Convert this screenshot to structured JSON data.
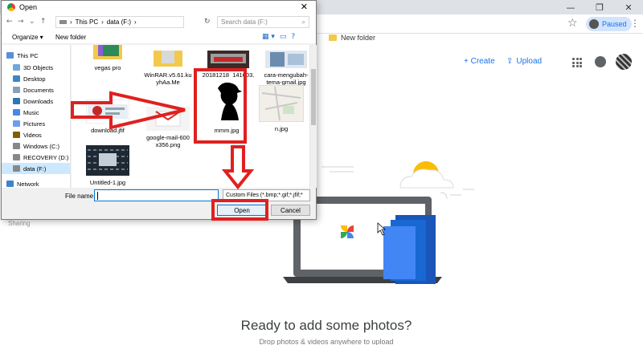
{
  "browser": {
    "window_controls": {
      "minimize": "—",
      "restore": "❐",
      "close": "✕"
    },
    "star": "☆",
    "profile_status": "Paused",
    "menu": "⋮",
    "bookmark_folder": "New folder"
  },
  "photos": {
    "create_label": "+ Create",
    "upload_label": "Upload",
    "upload_icon": "⇪",
    "sharing_label": "Sharing",
    "ready_title": "Ready to add some photos?",
    "drop_hint": "Drop photos & videos anywhere to upload"
  },
  "dialog": {
    "title": "Open",
    "close": "✕",
    "nav": {
      "back": "←",
      "forward": "→",
      "dropdown": "⌄",
      "up": "↑"
    },
    "address": {
      "this_pc": "This PC",
      "sep": "›",
      "drive": "data (F:)"
    },
    "refresh": "↻",
    "search_placeholder": "Search data (F:)",
    "search_icon": "⌕",
    "organize_label": "Organize ▾",
    "new_folder_label": "New folder",
    "view_icons": {
      "view": "▦ ▾",
      "pane": "▭",
      "help": "?"
    },
    "nav_items": [
      {
        "label": "This PC",
        "color": "#5b8ed6"
      },
      {
        "label": "3D Objects",
        "color": "#6fa8dc"
      },
      {
        "label": "Desktop",
        "color": "#3d85c6"
      },
      {
        "label": "Documents",
        "color": "#8aa0b8"
      },
      {
        "label": "Downloads",
        "color": "#2e75b6"
      },
      {
        "label": "Music",
        "color": "#4a86e8"
      },
      {
        "label": "Pictures",
        "color": "#6d9eeb"
      },
      {
        "label": "Videos",
        "color": "#7f6000"
      },
      {
        "label": "Windows (C:)",
        "color": "#888888"
      },
      {
        "label": "RECOVERY (D:)",
        "color": "#888888"
      },
      {
        "label": "data (F:)",
        "color": "#888888"
      },
      {
        "label": "Network",
        "color": "#3d85c6"
      }
    ],
    "files": [
      {
        "name": "vegas pro",
        "kind": "folder"
      },
      {
        "name": "WinRAR.v5.61.ku\nyhAa.Me",
        "kind": "folder"
      },
      {
        "name": "20181218_141603.\n…",
        "kind": "image"
      },
      {
        "name": "cara-mengubah-\ntema-gmail.jpg",
        "kind": "image"
      },
      {
        "name": "download.jfif",
        "kind": "image"
      },
      {
        "name": "google-mail-600\nx356.png",
        "kind": "image"
      },
      {
        "name": "mmm.jpg",
        "kind": "silhouette"
      },
      {
        "name": "n.jpg",
        "kind": "map"
      },
      {
        "name": "Untitled-1.jpg",
        "kind": "image"
      }
    ],
    "file_name_label": "File name:",
    "file_name_value": "",
    "filter_label": "Custom Files (*.bmp;*.gif;*.jfif;*",
    "open_label": "Open",
    "cancel_label": "Cancel"
  },
  "colors": {
    "annotation_red": "#e02020",
    "google_blue": "#1a73e8"
  }
}
